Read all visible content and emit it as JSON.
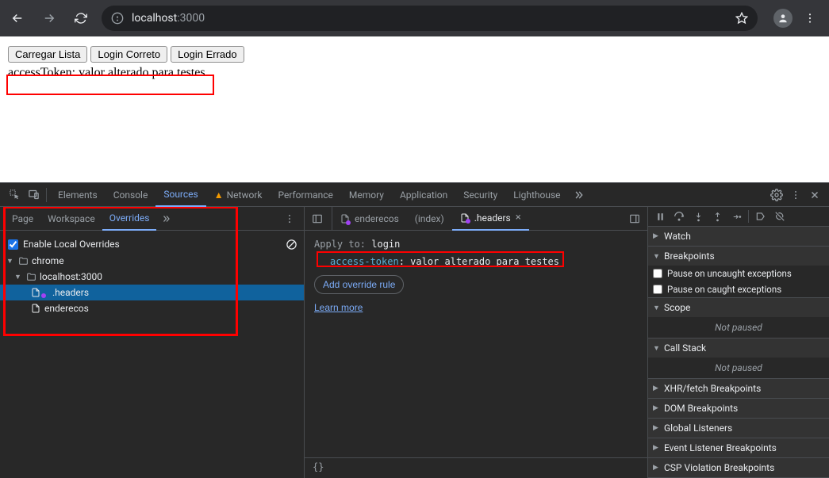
{
  "browser": {
    "url_host": "localhost",
    "url_port": ":3000"
  },
  "page": {
    "buttons": [
      "Carregar Lista",
      "Login Correto",
      "Login Errado"
    ],
    "text": "accessToken: valor alterado para testes"
  },
  "devtools": {
    "tabs": [
      "Elements",
      "Console",
      "Sources",
      "Network",
      "Performance",
      "Memory",
      "Application",
      "Security",
      "Lighthouse"
    ],
    "active_tab": "Sources",
    "left": {
      "tabs": [
        "Page",
        "Workspace",
        "Overrides"
      ],
      "active": "Overrides",
      "enable_label": "Enable Local Overrides",
      "tree": {
        "root": "chrome",
        "host": "localhost:3000",
        "files": [
          ".headers",
          "enderecos"
        ]
      }
    },
    "mid": {
      "open_tabs": [
        {
          "name": "enderecos",
          "active": false,
          "override": true
        },
        {
          "name": "(index)",
          "active": false,
          "override": false
        },
        {
          "name": ".headers",
          "active": true,
          "override": true
        }
      ],
      "apply_to_label": "Apply to",
      "apply_to_value": "login",
      "header_key": "access-token",
      "header_value": "valor alterado para testes",
      "add_rule": "Add override rule",
      "learn_more": "Learn more",
      "footer": "{}"
    },
    "right": {
      "sections": {
        "watch": "Watch",
        "breakpoints": "Breakpoints",
        "pause_uncaught": "Pause on uncaught exceptions",
        "pause_caught": "Pause on caught exceptions",
        "scope": "Scope",
        "not_paused": "Not paused",
        "call_stack": "Call Stack",
        "xhr": "XHR/fetch Breakpoints",
        "dom": "DOM Breakpoints",
        "global": "Global Listeners",
        "event": "Event Listener Breakpoints",
        "csp": "CSP Violation Breakpoints"
      }
    }
  }
}
